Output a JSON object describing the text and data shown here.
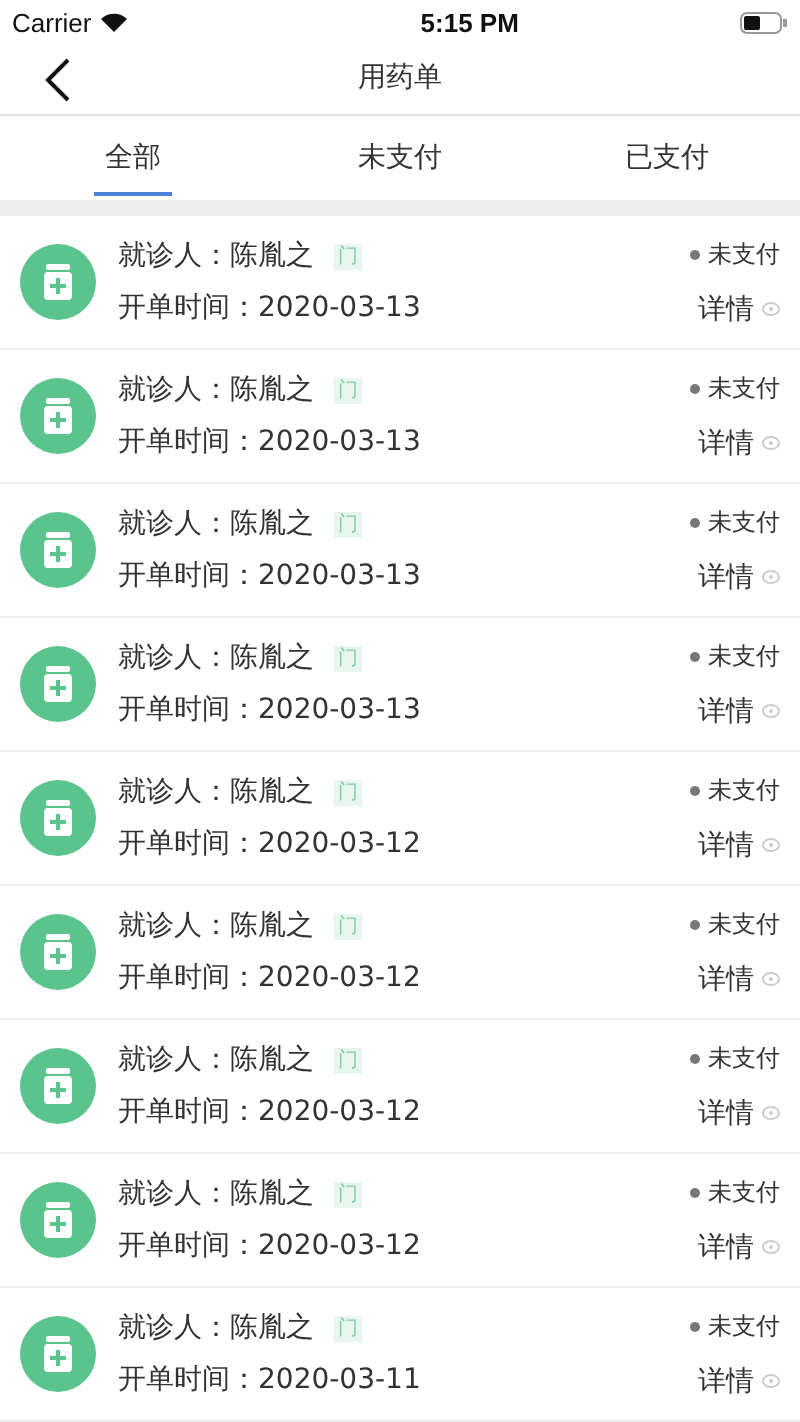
{
  "status_bar": {
    "carrier": "Carrier",
    "time": "5:15 PM"
  },
  "nav": {
    "title": "用药单"
  },
  "tabs": [
    {
      "label": "全部",
      "selected": true
    },
    {
      "label": "未支付",
      "selected": false
    },
    {
      "label": "已支付",
      "selected": false
    }
  ],
  "orders": [
    {
      "patient_label": "就诊人：",
      "patient": "陈胤之",
      "tag": "门",
      "date_label": "开单时间：",
      "date": "2020-03-13",
      "status": "未支付",
      "detail": "详情"
    },
    {
      "patient_label": "就诊人：",
      "patient": "陈胤之",
      "tag": "门",
      "date_label": "开单时间：",
      "date": "2020-03-13",
      "status": "未支付",
      "detail": "详情"
    },
    {
      "patient_label": "就诊人：",
      "patient": "陈胤之",
      "tag": "门",
      "date_label": "开单时间：",
      "date": "2020-03-13",
      "status": "未支付",
      "detail": "详情"
    },
    {
      "patient_label": "就诊人：",
      "patient": "陈胤之",
      "tag": "门",
      "date_label": "开单时间：",
      "date": "2020-03-13",
      "status": "未支付",
      "detail": "详情"
    },
    {
      "patient_label": "就诊人：",
      "patient": "陈胤之",
      "tag": "门",
      "date_label": "开单时间：",
      "date": "2020-03-12",
      "status": "未支付",
      "detail": "详情"
    },
    {
      "patient_label": "就诊人：",
      "patient": "陈胤之",
      "tag": "门",
      "date_label": "开单时间：",
      "date": "2020-03-12",
      "status": "未支付",
      "detail": "详情"
    },
    {
      "patient_label": "就诊人：",
      "patient": "陈胤之",
      "tag": "门",
      "date_label": "开单时间：",
      "date": "2020-03-12",
      "status": "未支付",
      "detail": "详情"
    },
    {
      "patient_label": "就诊人：",
      "patient": "陈胤之",
      "tag": "门",
      "date_label": "开单时间：",
      "date": "2020-03-12",
      "status": "未支付",
      "detail": "详情"
    },
    {
      "patient_label": "就诊人：",
      "patient": "陈胤之",
      "tag": "门",
      "date_label": "开单时间：",
      "date": "2020-03-11",
      "status": "未支付",
      "detail": "详情"
    }
  ]
}
